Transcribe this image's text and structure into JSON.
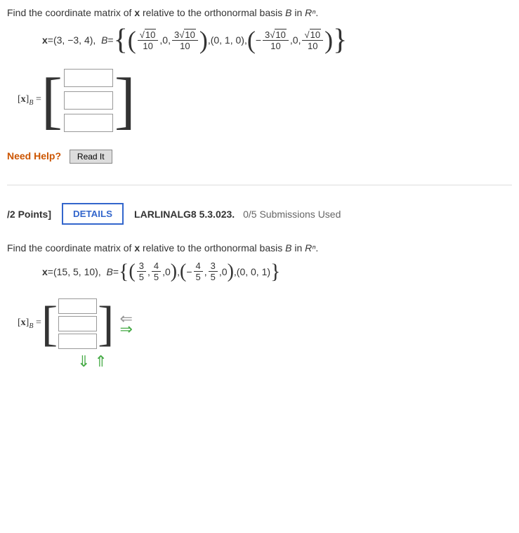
{
  "problem1": {
    "prompt_prefix": "Find the coordinate matrix of ",
    "prompt_var": "x",
    "prompt_mid": " relative to the orthonormal basis ",
    "prompt_basis": "B",
    "prompt_suffix": " in ",
    "prompt_space": "Rⁿ",
    "prompt_end": ".",
    "x_label": "x",
    "equals": " = ",
    "x_value": "(3, −3, 4)",
    "b_label": "B",
    "basis": {
      "v1_num1": "10",
      "v1_den1": "10",
      "v1_y": "0",
      "v1_num2_coef": "3",
      "v1_num2": "10",
      "v1_den2": "10",
      "v2": "(0, 1, 0)",
      "v3_neg": "−",
      "v3_num1_coef": "3",
      "v3_num1": "10",
      "v3_den1": "10",
      "v3_y": "0",
      "v3_num2": "10",
      "v3_den2": "10"
    },
    "answer_label_open": "[",
    "answer_label_x": "x",
    "answer_label_close": "]",
    "answer_label_sub": "B",
    "need_help": "Need Help?",
    "readit": "Read It"
  },
  "partHeader": {
    "points": "/2 Points]",
    "details": "DETAILS",
    "ref": "LARLINALG8 5.3.023.",
    "subs": "0/5 Submissions Used"
  },
  "problem2": {
    "prompt_prefix": "Find the coordinate matrix of ",
    "prompt_var": "x",
    "prompt_mid": " relative to the orthonormal basis ",
    "prompt_basis": "B",
    "prompt_suffix": " in ",
    "prompt_space": "Rⁿ",
    "prompt_end": ".",
    "x_label": "x",
    "equals": " = ",
    "x_value": "(15, 5, 10)",
    "b_label": "B",
    "basis": {
      "v1_n1": "3",
      "v1_d1": "5",
      "v1_n2": "4",
      "v1_d2": "5",
      "v1_z": "0",
      "v2_neg": "−",
      "v2_n1": "4",
      "v2_d1": "5",
      "v2_n2": "3",
      "v2_d2": "5",
      "v2_z": "0",
      "v3": "(0, 0, 1)"
    }
  }
}
